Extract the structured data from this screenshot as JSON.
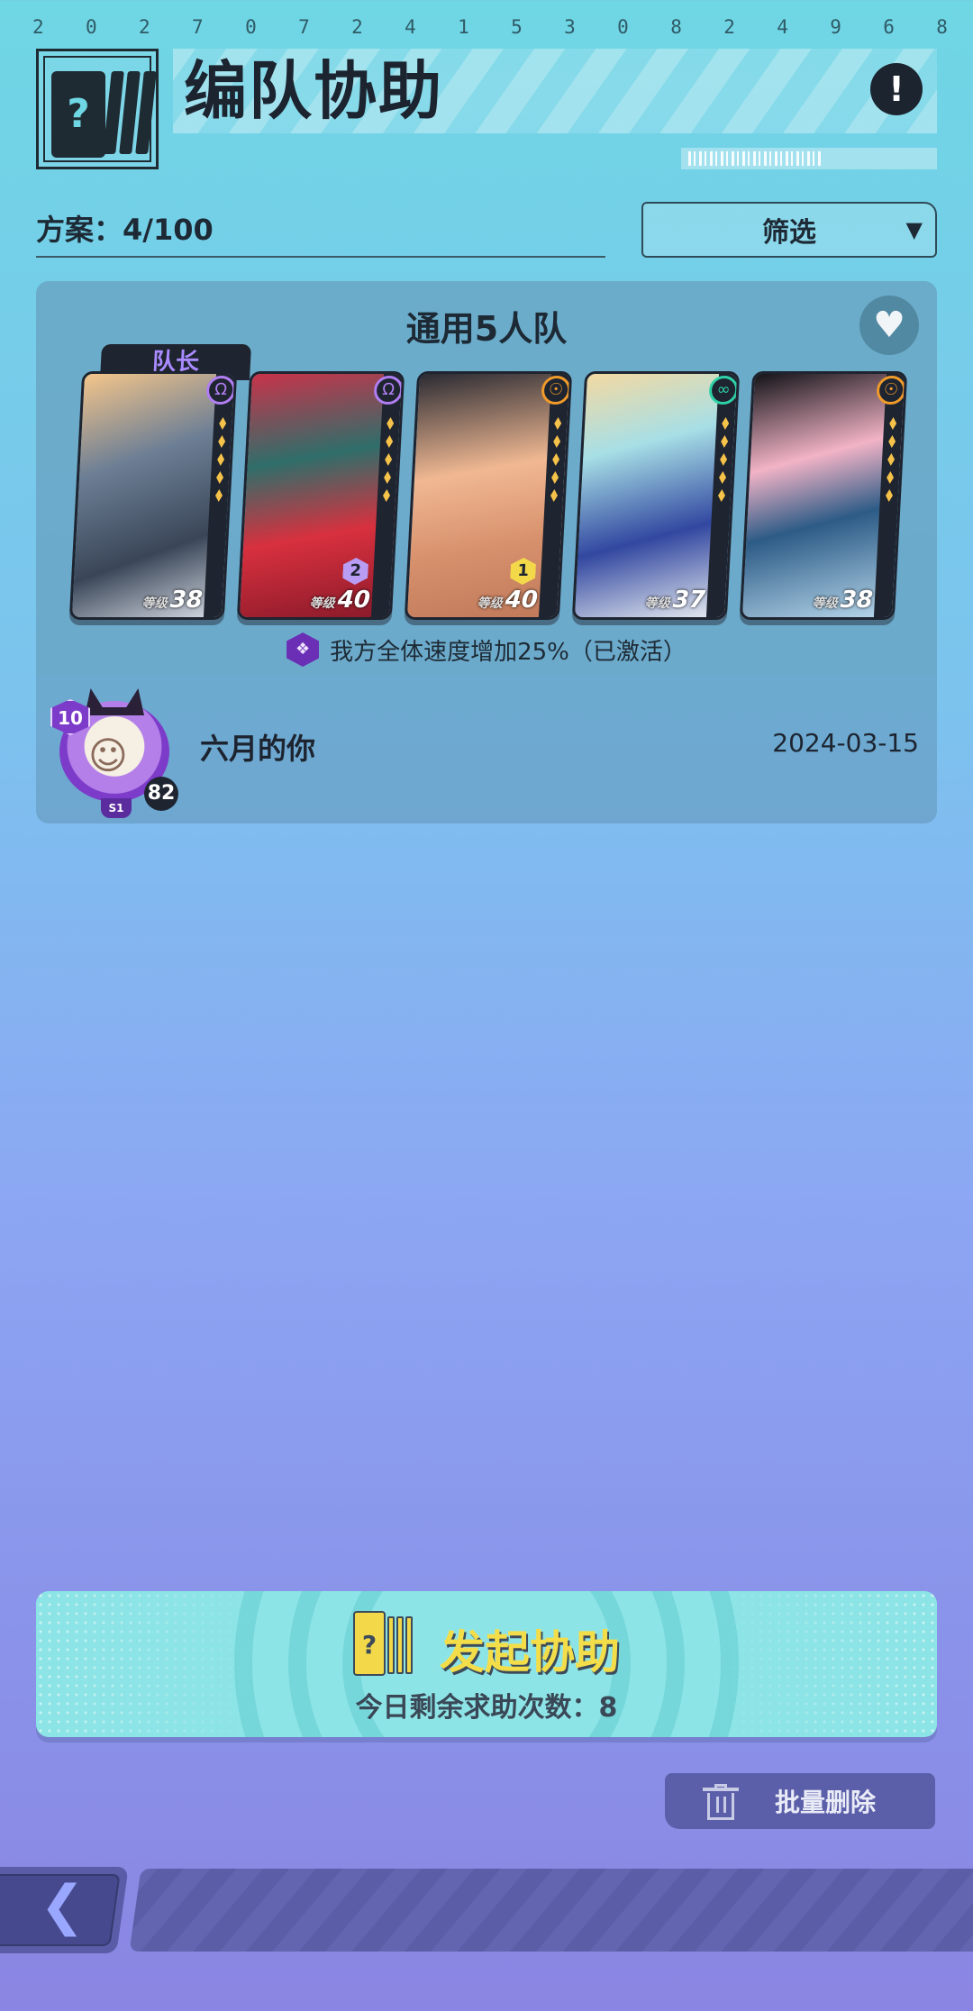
{
  "header": {
    "digits": [
      "2",
      "0",
      "2",
      "7",
      "0",
      "7",
      "2",
      "4",
      "1",
      "5",
      "3",
      "0",
      "8",
      "2",
      "4",
      "9",
      "6",
      "8"
    ],
    "title": "编队协助",
    "info_glyph": "!"
  },
  "plan": {
    "label": "方案：4/100"
  },
  "filter": {
    "label": "筛选",
    "arrow": "▼"
  },
  "team": {
    "title": "通用5人队",
    "leader_tag": "队长",
    "level_prefix": "等级",
    "members": [
      {
        "level": "38",
        "element_icon": "psychic-icon",
        "badge": ""
      },
      {
        "level": "40",
        "element_icon": "psychic-icon",
        "badge": "2"
      },
      {
        "level": "40",
        "element_icon": "sun-icon",
        "badge": "1"
      },
      {
        "level": "37",
        "element_icon": "swirl-icon",
        "badge": ""
      },
      {
        "level": "38",
        "element_icon": "sun-icon",
        "badge": ""
      }
    ],
    "buff": "我方全体速度增加25%（已激活）"
  },
  "owner": {
    "vip": "10",
    "level": "82",
    "season": "S1",
    "name": "六月的你",
    "date": "2024-03-15"
  },
  "assist": {
    "icon_glyph": "?",
    "label": "发起协助",
    "remaining": "今日剩余求助次数：8"
  },
  "batch_delete": {
    "label": "批量删除"
  },
  "nav": {
    "back_glyph": "❮"
  },
  "colors": {
    "accent_yellow": "#f3de4a",
    "dark": "#1c2430",
    "assist_bg": "#8de4e6",
    "batch_bg": "#5b5ea8"
  }
}
